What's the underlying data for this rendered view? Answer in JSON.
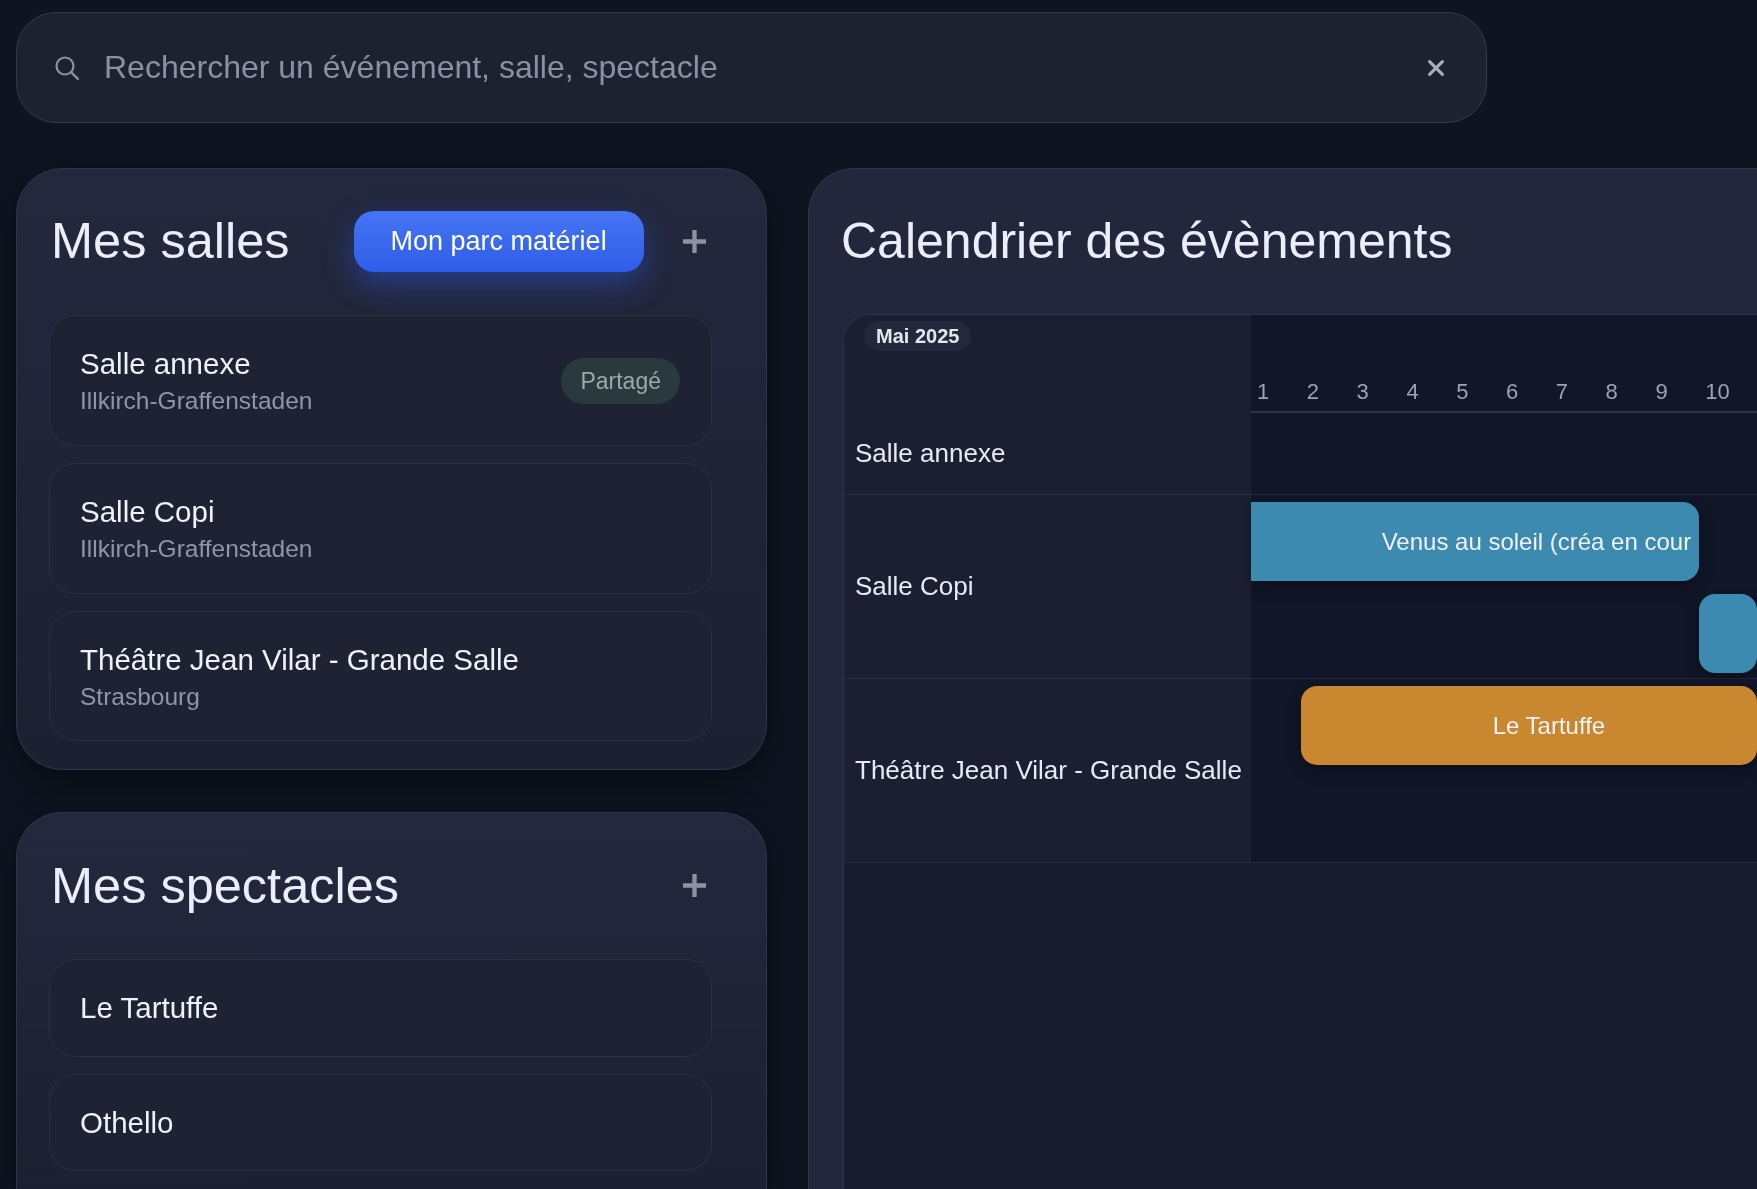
{
  "search": {
    "placeholder": "Rechercher un événement, salle, spectacle"
  },
  "rooms_panel": {
    "title": "Mes salles",
    "button": "Mon parc matériel",
    "rooms": [
      {
        "name": "Salle annexe",
        "city": "Illkirch-Graffenstaden",
        "badge": "Partagé"
      },
      {
        "name": "Salle Copi",
        "city": "Illkirch-Graffenstaden"
      },
      {
        "name": "Théâtre Jean Vilar - Grande Salle",
        "city": "Strasbourg"
      }
    ]
  },
  "shows_panel": {
    "title": "Mes spectacles",
    "shows": [
      {
        "title": "Le Tartuffe"
      },
      {
        "title": "Othello"
      }
    ]
  },
  "calendar": {
    "title": "Calendrier des évènements",
    "month": "Mai 2025",
    "days": [
      "1",
      "2",
      "3",
      "4",
      "5",
      "6",
      "7",
      "8",
      "9",
      "10"
    ],
    "rows": [
      {
        "room": "Salle annexe"
      },
      {
        "room": "Salle Copi",
        "events": [
          {
            "label": "Venus au soleil (créa en cour",
            "color": "#3d8ab1",
            "continues_before": true
          },
          {
            "color": "#3d8ab1",
            "continues_before": false
          }
        ]
      },
      {
        "room": "Théâtre Jean Vilar - Grande Salle",
        "events": [
          {
            "label": "Le Tartuffe",
            "color": "#c98830",
            "continues_before": false
          }
        ]
      }
    ]
  }
}
